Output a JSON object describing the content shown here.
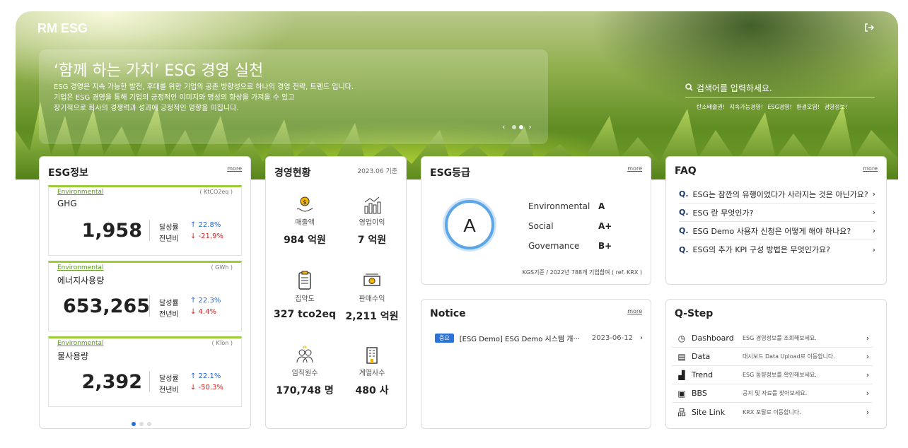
{
  "header": {
    "logo": "RM ESG",
    "logout_icon": "logout-icon"
  },
  "banner": {
    "title": "‘함께 하는 가치’ ESG 경영 실천",
    "text": "ESG 경영은 지속 가능한 발전, 후대를 위한 기업의 공존 방향성으로 하나의 경영 전략, 트렌드 입니다.\n기업은 ESG 경영을 통해 기업의 긍정적인 이미지와 명성의 향상을 가져올 수 있고\n장기적으로 회사의 경쟁력과 성과에 긍정적인 영향을 미칩니다.",
    "prev": "‹",
    "next": "›"
  },
  "search": {
    "placeholder": "검색어를 입력하세요.",
    "tags": "탄소배출권! 지속가능경영! ESG경영! 환경오염! 경영정보!"
  },
  "esg_info": {
    "title": "ESG정보",
    "more": "more",
    "items": [
      {
        "category": "Environmental",
        "unit": "( KtCO2eq )",
        "name": "GHG",
        "value": "1,958",
        "label1": "달성률",
        "label2": "전년비",
        "rate": "↑ 22.8%",
        "yoy": "↓ -21.9%"
      },
      {
        "category": "Environmental",
        "unit": "( GWh )",
        "name": "에너지사용량",
        "value": "653,265",
        "label1": "달성률",
        "label2": "전년비",
        "rate": "↑ 22.3%",
        "yoy": "↓ 4.4%"
      },
      {
        "category": "Environmental",
        "unit": "( KTon )",
        "name": "물사용량",
        "value": "2,392",
        "label1": "달성률",
        "label2": "전년비",
        "rate": "↑ 22.1%",
        "yoy": "↓ -50.3%"
      }
    ]
  },
  "management": {
    "title": "경영현황",
    "date": "2023.06 기준",
    "items": [
      {
        "icon": "money-bag-icon",
        "label": "매출액",
        "value": "984 억원"
      },
      {
        "icon": "growth-chart-icon",
        "label": "영업이익",
        "value": "7 억원"
      },
      {
        "icon": "clipboard-icon",
        "label": "집약도",
        "value": "327 tco2eq"
      },
      {
        "icon": "cash-icon",
        "label": "판매수익",
        "value": "2,211 억원"
      },
      {
        "icon": "people-icon",
        "label": "임직원수",
        "value": "170,748 명"
      },
      {
        "icon": "building-icon",
        "label": "계열사수",
        "value": "480 사"
      }
    ]
  },
  "esg_grade": {
    "title": "ESG등급",
    "more": "more",
    "overall": "A",
    "rows": [
      {
        "label": "Environmental",
        "grade": "A"
      },
      {
        "label": "Social",
        "grade": "A+"
      },
      {
        "label": "Governance",
        "grade": "B+"
      }
    ],
    "footnote": "KGS기준 / 2022년 788개 기업참여 ( ref. KRX )"
  },
  "notice": {
    "title": "Notice",
    "more": "more",
    "items": [
      {
        "badge": "중요",
        "text": "[ESG Demo] ESG Demo 시스템 개···",
        "date": "2023-06-12"
      }
    ]
  },
  "faq": {
    "title": "FAQ",
    "more": "more",
    "items": [
      "ESG는 잠깐의 유행이었다가 사라지는 것은 아닌가요?!",
      "ESG 란 무엇인가?",
      "ESG Demo 사용자 신청은 어떻게 해야 하나요?",
      "ESG의 추가 KPI 구성 방법은 무엇인가요?"
    ]
  },
  "qstep": {
    "title": "Q-Step",
    "items": [
      {
        "icon": "clock-icon",
        "name": "Dashboard",
        "desc": "ESG 경영정보를 조회해보세요."
      },
      {
        "icon": "database-icon",
        "name": "Data",
        "desc": "대시보드 Data Upload로 이동합니다."
      },
      {
        "icon": "trend-icon",
        "name": "Trend",
        "desc": "ESG 동향정보를 확인해보세요."
      },
      {
        "icon": "document-icon",
        "name": "BBS",
        "desc": "공지 및 자료를 찾아보세요."
      },
      {
        "icon": "sitemap-icon",
        "name": "Site Link",
        "desc": "KRX 포탈로 이동합니다."
      }
    ]
  },
  "colors": {
    "accent_blue": "#2a73d9",
    "green": "#9ccc3a",
    "ring": "#5aa6e8"
  }
}
